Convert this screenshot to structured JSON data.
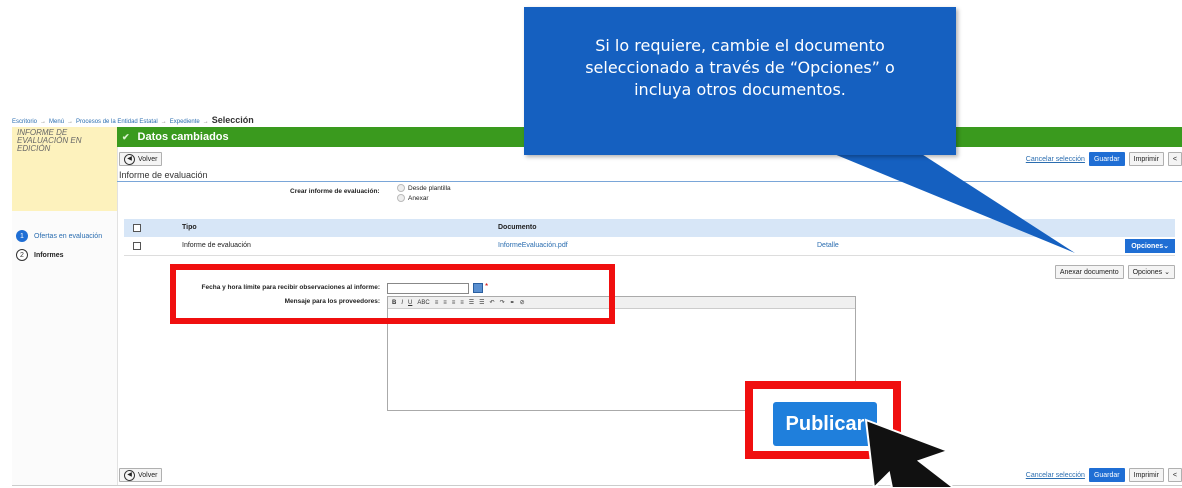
{
  "breadcrumb": {
    "items": [
      "Escritorio",
      "Menú",
      "Procesos de la Entidad Estatal",
      "Expediente"
    ],
    "current": "Selección"
  },
  "sidebar": {
    "status": "INFORME DE EVALUACIÓN EN EDICIÓN",
    "steps": [
      {
        "num": "1",
        "label": "Ofertas en evaluación"
      },
      {
        "num": "2",
        "label": "Informes"
      }
    ]
  },
  "header": {
    "title": "Datos cambiados"
  },
  "toolbar": {
    "back_label": "Volver",
    "cancel_label": "Cancelar selección",
    "save_label": "Guardar",
    "print_label": "Imprimir",
    "collapse_label": "<"
  },
  "section": {
    "title": "Informe de evaluación"
  },
  "create_report": {
    "label": "Crear informe de evaluación:",
    "options": [
      "Desde plantilla",
      "Anexar"
    ]
  },
  "table": {
    "headers": {
      "tipo": "Tipo",
      "documento": "Documento"
    },
    "rows": [
      {
        "tipo": "Informe de evaluación",
        "documento": "InformeEvaluación.pdf",
        "detalle": "Detalle",
        "opciones": "Opciones"
      }
    ]
  },
  "annex": {
    "attach_label": "Anexar documento",
    "options_label": "Opciones"
  },
  "form": {
    "deadline_label": "Fecha y hora límite para recibir observaciones al informe:",
    "deadline_value": "",
    "required_mark": "*",
    "message_label": "Mensaje para los proveedores:",
    "editor_tools": [
      "B",
      "I",
      "U",
      "ABC",
      "≡",
      "≡",
      "≡",
      "≡",
      "☰",
      "☰",
      "↶",
      "↷",
      "⚭",
      "⊘"
    ]
  },
  "publish": {
    "label": "Publicar"
  },
  "callout": {
    "lines": [
      "Si lo requiere, cambie el documento",
      "seleccionado a través de “Opciones” o",
      "incluya otros documentos."
    ]
  },
  "colors": {
    "accent_blue": "#1f6ed4",
    "header_green": "#3a9a1e",
    "highlight_red": "#f00f0f",
    "callout_blue": "#1560c0"
  }
}
